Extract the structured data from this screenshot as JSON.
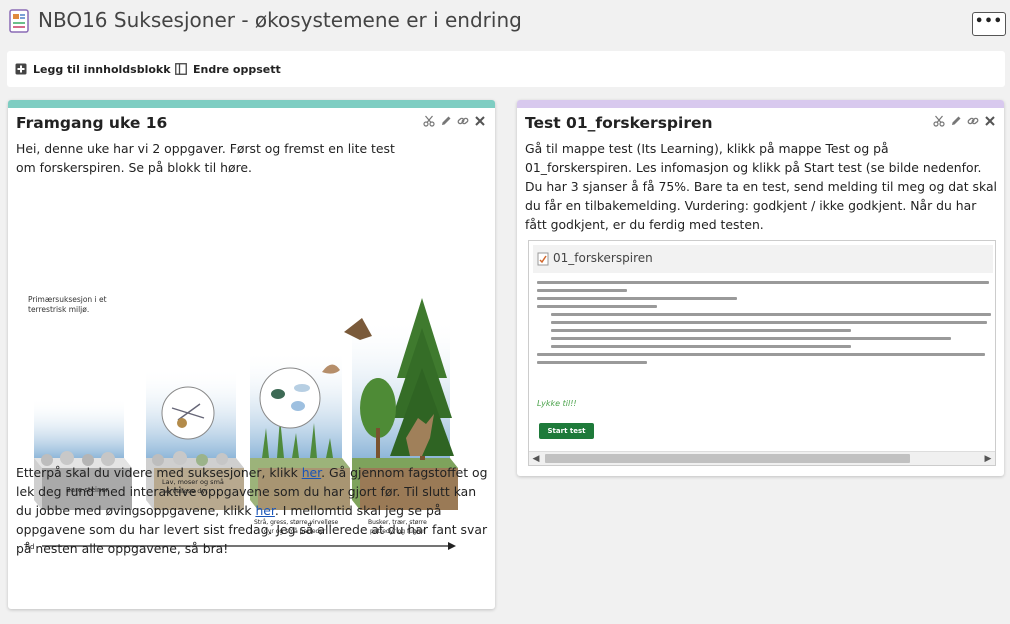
{
  "header": {
    "title": "NBO16 Suksesjoner - økosystemene er i endring",
    "more_label": "•••"
  },
  "toolbar": {
    "add_block_label": "Legg til innholdsblokk",
    "edit_layout_label": "Endre oppsett"
  },
  "cards": [
    {
      "title": "Framgang uke 16",
      "accent": "#7ecdc2",
      "intro": "Hei, denne uke har vi 2 oppgaver. Først og fremst en lite test om forskerspiren. Se på blokk til høre.",
      "figure": {
        "note_line1": "Primærsuksesjon i et",
        "note_line2": "terrestrisk miljø.",
        "stage1": "Bare steiner",
        "stage2a": "Lav, moser og små",
        "stage2b": "virvelløse dyr",
        "stage3a": "Strå, gress, større virvelløse",
        "stage3b": "dyr og små pattedyr",
        "stage4a": "Busker, trær, større",
        "stage4b": "pattedyr og fugler",
        "axis": "Tid"
      },
      "body_1": "Etterpå skal du videre med suksesjoner, klikk ",
      "link_1": "her",
      "body_2": ". Gå gjennom fagstoffet og lek deg rund med interaktive oppgavene som du har gjort før. Til slutt kan du jobbe med øvingsoppgavene, klikk ",
      "link_2": "her",
      "body_3": ". I mellomtid skal jeg se på oppgavene som du har levert sist fredag. Jeg så allerede at du har fant svar på nesten alle oppgavene, så bra!"
    },
    {
      "title": "Test 01_forskerspiren",
      "accent": "#d8c9ee",
      "body": "Gå til mappe test (Its Learning), klikk på mappe Test og på 01_forskerspiren. Les infomasjon og klikk på Start test (se bilde nedenfor. Du har 3 sjanser å få 75%. Bare ta en test, send melding til meg og dat skal du får en tilbakemelding. Vurdering: godkjent / ikke godkjent. Når du har fått godkjent, er du ferdig med testen.",
      "embedded": {
        "title": "01_forskerspiren",
        "lykke": "Lykke til!!",
        "start_button": "Start test"
      }
    }
  ]
}
